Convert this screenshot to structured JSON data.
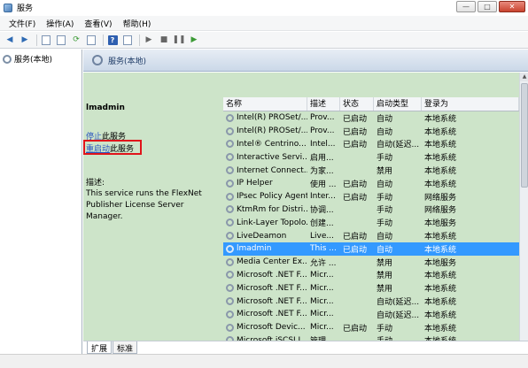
{
  "window": {
    "title": "服务",
    "min": "—",
    "max": "□",
    "close": "✕"
  },
  "menu": [
    "文件(F)",
    "操作(A)",
    "查看(V)",
    "帮助(H)"
  ],
  "tree": {
    "item": "服务(本地)"
  },
  "header": {
    "title": "服务(本地)"
  },
  "detail": {
    "service_name": "lmadmin",
    "stop_link": "停止",
    "stop_suffix": "此服务",
    "restart_link": "重启动",
    "restart_suffix": "此服务",
    "desc_label": "描述:",
    "description": "This service runs the FlexNet Publisher License Server Manager."
  },
  "table": {
    "columns": [
      "名称",
      "描述",
      "状态",
      "启动类型",
      "登录为"
    ],
    "rows": [
      [
        "Intel(R) PROSet/...",
        "Prov...",
        "已启动",
        "自动",
        "本地系统"
      ],
      [
        "Intel(R) PROSet/...",
        "Prov...",
        "已启动",
        "自动",
        "本地系统"
      ],
      [
        "Intel® Centrino...",
        "Intel...",
        "已启动",
        "自动(延迟...",
        "本地系统"
      ],
      [
        "Interactive Servi...",
        "启用...",
        "",
        "手动",
        "本地系统"
      ],
      [
        "Internet Connect...",
        "为家...",
        "",
        "禁用",
        "本地系统"
      ],
      [
        "IP Helper",
        "使用 ...",
        "已启动",
        "自动",
        "本地系统"
      ],
      [
        "IPsec Policy Agent",
        "Inter...",
        "已启动",
        "手动",
        "网络服务"
      ],
      [
        "KtmRm for Distri...",
        "协调...",
        "",
        "手动",
        "网络服务"
      ],
      [
        "Link-Layer Topolo...",
        "创建...",
        "",
        "手动",
        "本地服务"
      ],
      [
        "LiveDeamon",
        "Live...",
        "已启动",
        "自动",
        "本地系统"
      ],
      [
        "lmadmin",
        "This ...",
        "已启动",
        "自动",
        "本地系统"
      ],
      [
        "Media Center Ex...",
        "允许 ...",
        "",
        "禁用",
        "本地服务"
      ],
      [
        "Microsoft .NET F...",
        "Micr...",
        "",
        "禁用",
        "本地系统"
      ],
      [
        "Microsoft .NET F...",
        "Micr...",
        "",
        "禁用",
        "本地系统"
      ],
      [
        "Microsoft .NET F...",
        "Micr...",
        "",
        "自动(延迟...",
        "本地系统"
      ],
      [
        "Microsoft .NET F...",
        "Micr...",
        "",
        "自动(延迟...",
        "本地系统"
      ],
      [
        "Microsoft Devic...",
        "Micr...",
        "已启动",
        "手动",
        "本地系统"
      ],
      [
        "Microsoft iSCSI I...",
        "管理 ...",
        "",
        "手动",
        "本地系统"
      ],
      [
        "Microsoft Softw...",
        "管理...",
        "",
        "手动",
        "本地系统"
      ]
    ],
    "selected_row": "lmadmin"
  },
  "tabs": [
    "扩展",
    "标准"
  ],
  "icons": [
    "back-icon",
    "forward-icon",
    "console-tree-icon",
    "properties-icon",
    "refresh-icon",
    "export-icon",
    "help-icon",
    "start-icon",
    "stop-icon",
    "pause-icon",
    "resume-icon",
    "service-gear-icon"
  ],
  "colors": {
    "detail_bg": "#cde4c9",
    "selection": "#3399ff",
    "link": "#2a55c0",
    "highlight_box": "#e0141a"
  }
}
